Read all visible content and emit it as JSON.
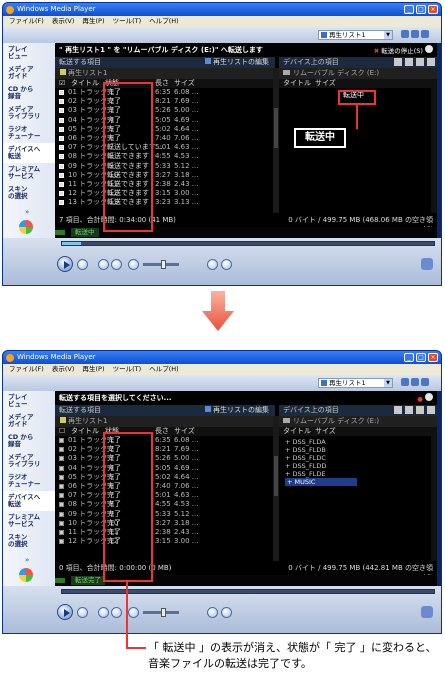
{
  "window": {
    "title": "Windows Media Player",
    "menus": [
      "ファイル(F)",
      "表示(V)",
      "再生(P)",
      "ツール(T)",
      "ヘルプ(H)"
    ]
  },
  "sidebar": [
    "プレイ\nビュー",
    "メディア\nガイド",
    "CD から\n録音",
    "メディア\nライブラリ",
    "ラジオ\nチューナー",
    "デバイスへ\n転送",
    "プレミアム\nサービス",
    "スキン\nの選択"
  ],
  "playlist_selector": "再生リスト1",
  "left_header": "転送する項目",
  "edit_playlist": "再生リストの編集(A)",
  "left_playlist_label": "再生リスト1",
  "right_header": "デバイス上の項目",
  "device_label": "リムーバブル ディスク (E:)",
  "columns_left": [
    "タイトル",
    "状態",
    "長さ",
    "サイズ"
  ],
  "columns_right": [
    "タイトル",
    "サイズ"
  ],
  "top": {
    "banner": "\" 再生リスト1 \" を \"リムーバブル ディスク (E:)\" へ転送します",
    "stop_label": "転送の停止(S)",
    "statuses": [
      "完了",
      "完了",
      "完了",
      "完了",
      "完了",
      "完了",
      "転送しています...",
      "転送できます",
      "転送できます",
      "転送できます",
      "転送できます",
      "転送できます",
      "転送できます"
    ],
    "footer_left": "7 項目、合計時間: 0:34:00 (41 MB)",
    "footer_right": "0 バイト / 499.75 MB (468.06 MB の空き領域)",
    "status_text": "転送中",
    "progress": 0.05
  },
  "bottom": {
    "banner": "転送する項目を選択してください...",
    "statuses": [
      "完了",
      "完了",
      "完了",
      "完了",
      "完了",
      "完了",
      "完了",
      "完了",
      "完了",
      "完了",
      "完了",
      "完了"
    ],
    "footer_left": "0 項目、合計時間: 0:00:00 (0 MB)",
    "footer_right": "0 バイト / 499.75 MB (442.81 MB の空き領域)",
    "status_text": "転送完了",
    "progress": 0.0,
    "device_tree": [
      "DSS_FLDA",
      "DSS_FLDB",
      "DSS_FLDC",
      "DSS_FLDD",
      "DSS_FLDE",
      "MUSIC"
    ]
  },
  "tracks": [
    {
      "title": "01 トラック 1",
      "length": "6:35",
      "size": "6.08 ..."
    },
    {
      "title": "02 トラック 2",
      "length": "8:21",
      "size": "7.69 ..."
    },
    {
      "title": "03 トラック 3",
      "length": "5:26",
      "size": "5.00 ..."
    },
    {
      "title": "04 トラック 4",
      "length": "5:05",
      "size": "4.69 ..."
    },
    {
      "title": "05 トラック 5",
      "length": "5:02",
      "size": "4.64 ..."
    },
    {
      "title": "06 トラック 6",
      "length": "7:40",
      "size": "7.06 ..."
    },
    {
      "title": "07 トラック 7",
      "length": "5:01",
      "size": "4.63 ..."
    },
    {
      "title": "08 トラック 8",
      "length": "4:55",
      "size": "4.53 ..."
    },
    {
      "title": "09 トラック 9",
      "length": "5:33",
      "size": "5.12 ..."
    },
    {
      "title": "10 トラック 10",
      "length": "3:27",
      "size": "3.18 ..."
    },
    {
      "title": "11 トラック 11",
      "length": "2:38",
      "size": "2.43 ..."
    },
    {
      "title": "12 トラック 12",
      "length": "3:15",
      "size": "3.00 ..."
    },
    {
      "title": "13 トラック 13",
      "length": "3:23",
      "size": "3.13 ..."
    }
  ],
  "top_right_item": "転送中",
  "callout": "転送中",
  "caption": "「 転送中 」の表示が消え、状態が「 完了 」に変わると、音楽ファイルの転送は完了です。",
  "colors": {
    "highlight": "#e33333",
    "titlebar": "#0a50d8",
    "arrow": "#e8503a"
  }
}
